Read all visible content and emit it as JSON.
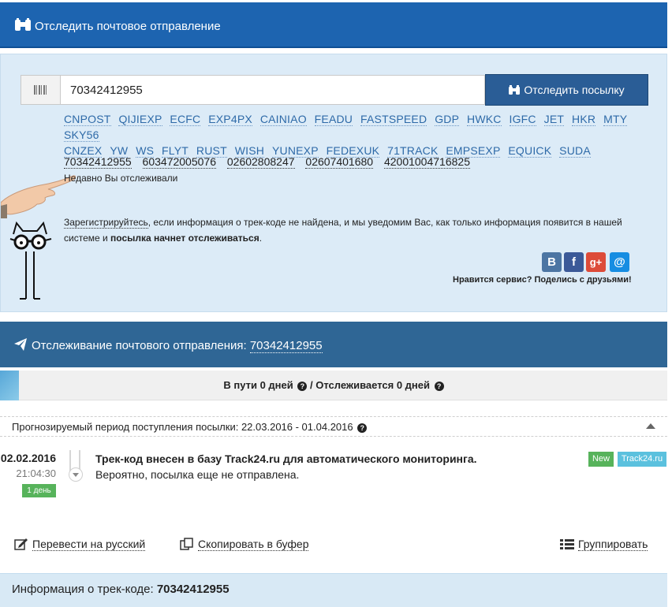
{
  "header": {
    "title": "Отследить почтовое отправление",
    "icon": "binoculars-icon"
  },
  "search": {
    "input_value": "70342412955",
    "button_label": "Отследить посылку",
    "carriers": [
      "CNPOST",
      "QIJIEXP",
      "ECFC",
      "EXP4PX",
      "CAINIAO",
      "FEADU",
      "FASTSPEED",
      "GDP",
      "HWKC",
      "IGFC",
      "JET",
      "HKR",
      "MTY",
      "SKY56",
      "CNZEX",
      "YW",
      "WS",
      "FLYT",
      "RUST",
      "WISH",
      "YUNEXP",
      "FEDEXUK",
      "71TRACK",
      "EMPSEXP",
      "EQUICK",
      "SUDA"
    ],
    "recent_codes": [
      "70342412955",
      "603472005076",
      "02602808247",
      "02607401680",
      "42001004716825"
    ],
    "recent_label": "Недавно Вы отслеживали"
  },
  "info": {
    "register_link": "Зарегистрируйтесь",
    "text_part1": ", если информация о трек-коде не найдена, и мы уведомим Вас, как только информация появится в нашей системе и ",
    "text_bold": "посылка начнет отслеживаться",
    "text_end": "."
  },
  "social": {
    "share_text": "Нравится сервис? Поделись с друзьями!",
    "buttons": [
      {
        "name": "vk",
        "label": "B",
        "color": "#4c75a3"
      },
      {
        "name": "facebook",
        "label": "f",
        "color": "#3b5998"
      },
      {
        "name": "google-plus",
        "label": "g+",
        "color": "#dd4b39"
      },
      {
        "name": "mail",
        "label": "@",
        "color": "#168de2"
      }
    ]
  },
  "tracking": {
    "title_prefix": "Отслеживание почтового отправления: ",
    "code": "70342412955",
    "status": "В пути 0 дней",
    "separator": " / ",
    "tracked": "Отслеживается 0 дней",
    "forecast": "Прогнозируемый период поступления посылки: 22.03.2016 - 01.04.2016"
  },
  "event": {
    "date": "02.02.2016",
    "time": "21:04:30",
    "days_badge": "1 день",
    "title": "Трек-код внесен в базу Track24.ru для автоматического мониторинга.",
    "description": "Вероятно, посылка еще не отправлена.",
    "badge_new": "New",
    "badge_source": "Track24.ru"
  },
  "actions": {
    "translate": "Перевести на русский",
    "copy": "Скопировать в буфер",
    "group": "Группировать"
  },
  "footer": {
    "label": "Информация о трек-коде: ",
    "code": "70342412955"
  },
  "colors": {
    "header_blue": "#1d64b0",
    "panel_bg": "#dcebf7",
    "tracking_header": "#2f6695",
    "badge_green": "#57b35b",
    "badge_cyan": "#5bc1de"
  }
}
